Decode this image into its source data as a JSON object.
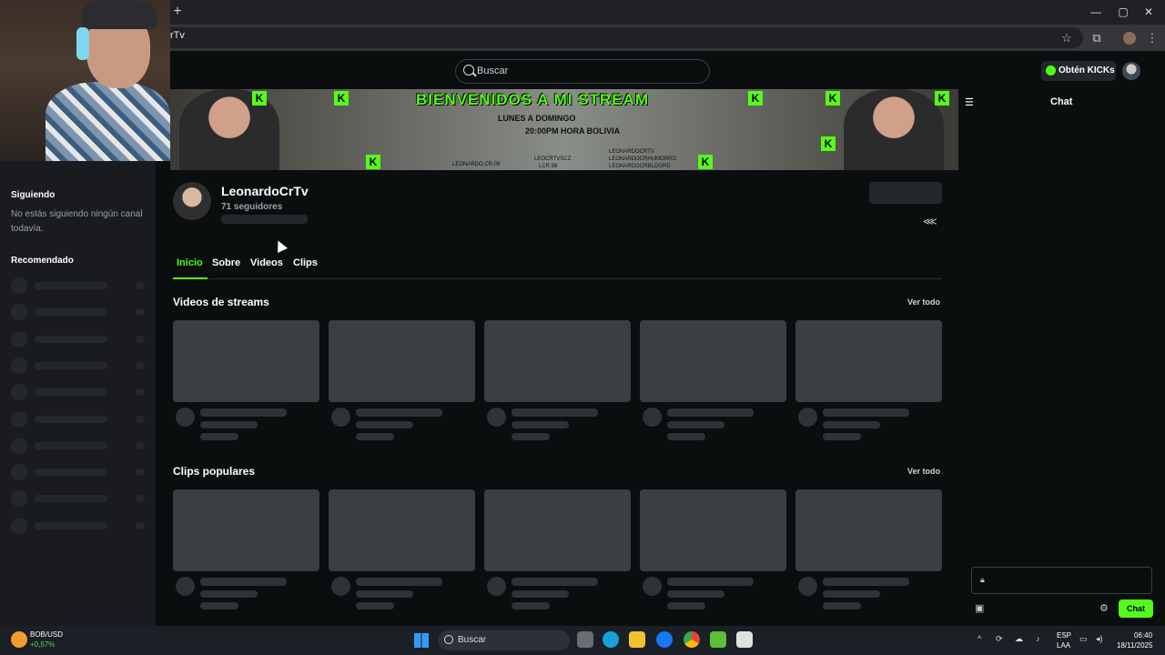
{
  "browser": {
    "url": "rTv",
    "new_tab": "+",
    "controls": {
      "minimize": "—",
      "maximize": "▢",
      "close": "✕"
    },
    "icons": [
      "star-icon",
      "extensions-icon",
      "profile-avatar",
      "menu-icon"
    ]
  },
  "header": {
    "search_placeholder": "Buscar",
    "kicks_label": "Obtén KICKs"
  },
  "sidebar": {
    "following_title": "Siguiendo",
    "following_empty": "No estás siguiendo ningún canal todavía.",
    "recommended_title": "Recomendado"
  },
  "banner": {
    "title": "BIENVENIDOS A MI STREAM",
    "days": "LUNES A DOMINGO",
    "hour": "20:00PM HORA BOLIVIA",
    "social_1": "LEONARDO.CR.09",
    "social_2": "LEOCRTVSCZ",
    "social_3": "LCR.98",
    "social_4": "LEONARDOCRTV",
    "social_5": "LEONARDOCRHUMORRO",
    "social_6": "LEONARDOCRBLOGRD"
  },
  "channel": {
    "name": "LeonardoCrTv",
    "followers": "71 seguidores"
  },
  "tabs": [
    {
      "label": "Inicio",
      "active": true
    },
    {
      "label": "Sobre",
      "active": false
    },
    {
      "label": "Videos",
      "active": false
    },
    {
      "label": "Clips",
      "active": false
    }
  ],
  "sections": {
    "streams_title": "Videos de streams",
    "clips_title": "Clips populares",
    "see_all": "Ver todo"
  },
  "chat": {
    "title": "Chat",
    "send_label": "Chat"
  },
  "taskbar": {
    "pair": "BOB/USD",
    "change": "+0,57%",
    "search_placeholder": "Buscar",
    "lang_1": "ESP",
    "lang_2": "LAA",
    "time": "06:40",
    "date": "18/11/2025"
  },
  "colors": {
    "accent": "#53fc18",
    "background": "#0b0e0f",
    "sidebar": "#191b1f",
    "skeleton": "#3b3e42"
  }
}
